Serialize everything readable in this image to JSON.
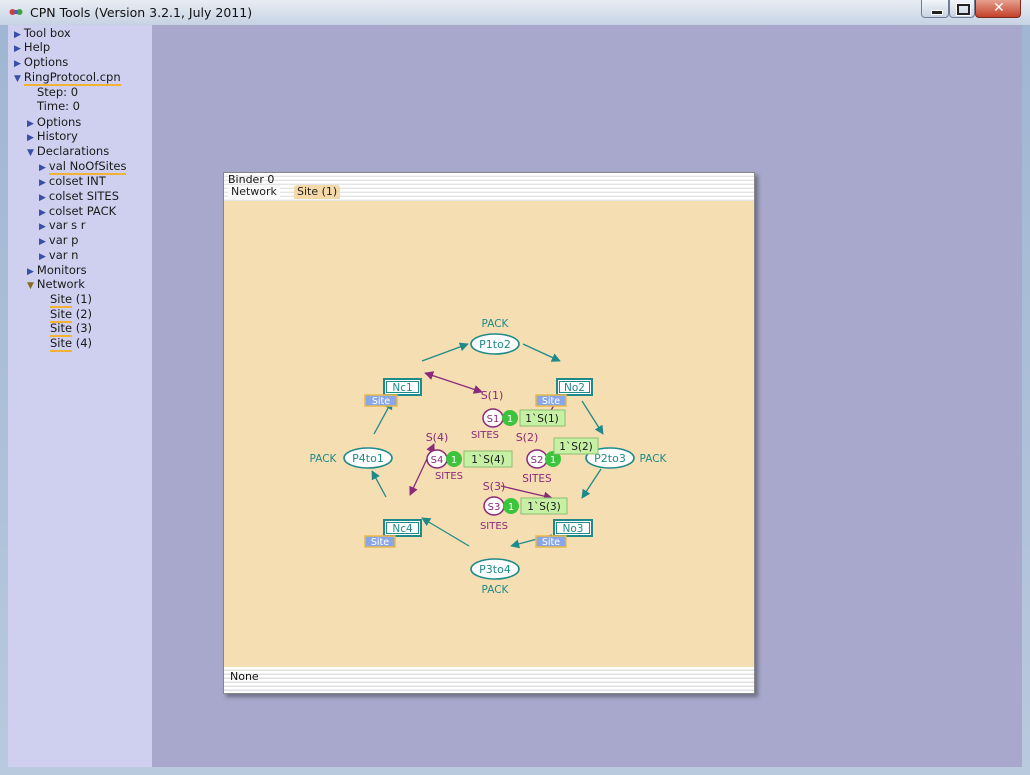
{
  "window": {
    "title": "CPN Tools (Version 3.2.1, July 2011)"
  },
  "index": {
    "toolbox": "Tool box",
    "help": "Help",
    "options": "Options",
    "net": "RingProtocol.cpn",
    "step": "Step: 0",
    "time": "Time: 0",
    "net_options": "Options",
    "history": "History",
    "declarations": "Declarations",
    "decls": [
      "val NoOfSites",
      "colset INT",
      "colset SITES",
      "colset PACK",
      "var s r",
      "var p",
      "var n"
    ],
    "monitors": "Monitors",
    "network": "Network",
    "pages": [
      {
        "name": "Site",
        "num": "(1)"
      },
      {
        "name": "Site",
        "num": "(2)"
      },
      {
        "name": "Site",
        "num": "(3)"
      },
      {
        "name": "Site",
        "num": "(4)"
      }
    ]
  },
  "binder": {
    "title": "Binder 0",
    "tabs": [
      "Network",
      "Site (1)"
    ],
    "status": "None"
  },
  "net": {
    "places": [
      {
        "name": "P1to2",
        "type": "PACK"
      },
      {
        "name": "P2to3",
        "type": "PACK"
      },
      {
        "name": "P3to4",
        "type": "PACK"
      },
      {
        "name": "P4to1",
        "type": "PACK"
      }
    ],
    "transitions": [
      {
        "name": "Nc1",
        "tag": "Site"
      },
      {
        "name": "No2",
        "tag": "Site"
      },
      {
        "name": "No3",
        "tag": "Site"
      },
      {
        "name": "Nc4",
        "tag": "Site"
      }
    ],
    "site_places": [
      {
        "name": "S1",
        "type": "SITES",
        "arc": "S(1)",
        "count": "1",
        "marking": "1`S(1)"
      },
      {
        "name": "S2",
        "type": "SITES",
        "arc": "S(2)",
        "count": "1",
        "marking": "1`S(2)"
      },
      {
        "name": "S3",
        "type": "SITES",
        "arc": "S(3)",
        "count": "1",
        "marking": "1`S(3)"
      },
      {
        "name": "S4",
        "type": "SITES",
        "arc": "S(4)",
        "count": "1",
        "marking": "1`S(4)"
      }
    ]
  },
  "colors": {
    "net_teal": "#1f8a8a",
    "site_purple": "#8a2a7a",
    "token_green": "#3cc43c",
    "marking_bg": "#c6f0a4",
    "tag_blue": "#8aa6e6",
    "tag_border": "#e8b84a",
    "canvas": "#f5deb2",
    "index_bg": "#cfd0ef",
    "workspace": "#a8a8cc"
  }
}
